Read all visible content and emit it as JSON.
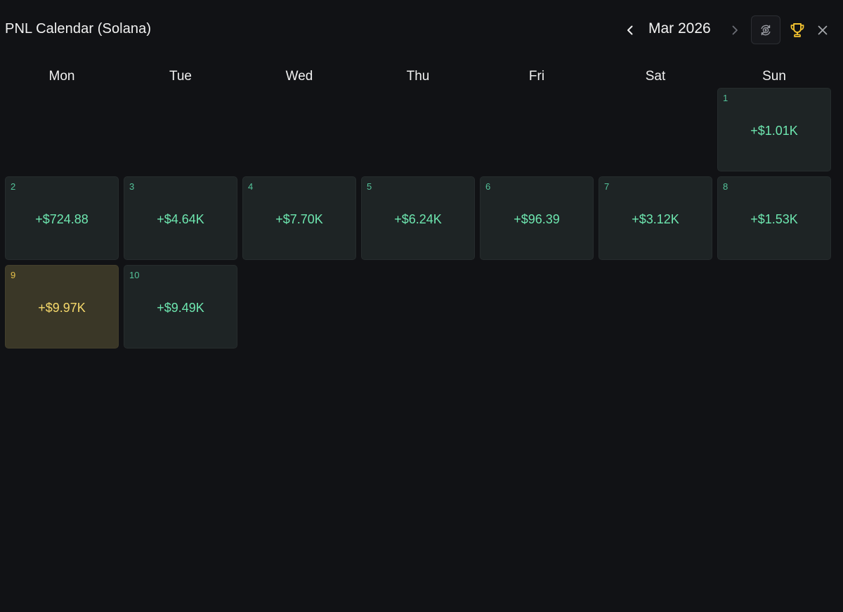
{
  "header": {
    "title": "PNL Calendar (Solana)",
    "month_label": "Mar 2026",
    "icons": {
      "prev": "chevron-left-icon",
      "next": "chevron-right-icon",
      "currency": "currency-swap-icon",
      "trophy": "trophy-icon",
      "close": "close-icon"
    },
    "colors": {
      "trophy": "#f2c230",
      "next_disabled": "#6b6e75"
    }
  },
  "weekdays": [
    "Mon",
    "Tue",
    "Wed",
    "Thu",
    "Fri",
    "Sat",
    "Sun"
  ],
  "days": [
    {
      "day": "1",
      "pnl": "+$1.01K",
      "weekday": "Sun",
      "week": 1,
      "highlight": false
    },
    {
      "day": "2",
      "pnl": "+$724.88",
      "weekday": "Mon",
      "week": 2,
      "highlight": false
    },
    {
      "day": "3",
      "pnl": "+$4.64K",
      "weekday": "Tue",
      "week": 2,
      "highlight": false
    },
    {
      "day": "4",
      "pnl": "+$7.70K",
      "weekday": "Wed",
      "week": 2,
      "highlight": false
    },
    {
      "day": "5",
      "pnl": "+$6.24K",
      "weekday": "Thu",
      "week": 2,
      "highlight": false
    },
    {
      "day": "6",
      "pnl": "+$96.39",
      "weekday": "Fri",
      "week": 2,
      "highlight": false
    },
    {
      "day": "7",
      "pnl": "+$3.12K",
      "weekday": "Sat",
      "week": 2,
      "highlight": false
    },
    {
      "day": "8",
      "pnl": "+$1.53K",
      "weekday": "Sun",
      "week": 2,
      "highlight": false
    },
    {
      "day": "9",
      "pnl": "+$9.97K",
      "weekday": "Mon",
      "week": 3,
      "highlight": true
    },
    {
      "day": "10",
      "pnl": "+$9.49K",
      "weekday": "Tue",
      "week": 3,
      "highlight": false
    }
  ],
  "colors": {
    "background": "#111215",
    "cell_bg": "#1e2425",
    "positive": "#6ee7b0",
    "best_day_bg": "#3a3727",
    "best_day_text": "#f6d96b"
  }
}
